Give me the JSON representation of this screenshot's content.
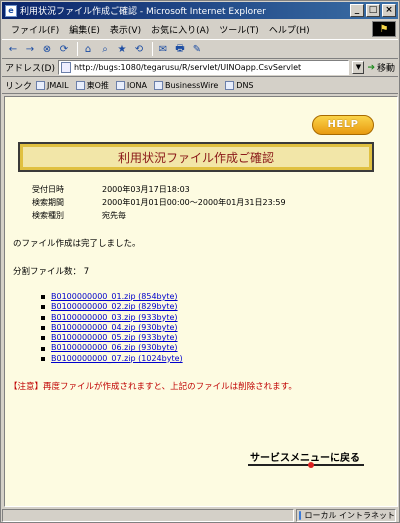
{
  "window": {
    "title": "利用状況ファイル作成ご確認 - Microsoft Internet Explorer",
    "app_icon": "e",
    "controls": [
      "_",
      "□",
      "×"
    ]
  },
  "menubar": {
    "items": [
      "ファイル(F)",
      "編集(E)",
      "表示(V)",
      "お気に入り(A)",
      "ツール(T)",
      "ヘルプ(H)"
    ]
  },
  "toolbar": {
    "buttons": [
      "←",
      "→",
      "⊗",
      "⟳",
      "⌂",
      "⌕",
      "★",
      "⟲",
      "✉",
      "🖶",
      "✎"
    ]
  },
  "address": {
    "label": "アドレス(D)",
    "url": "http://bugs:1080/tegarusu/R/servlet/UINOapp.CsvServlet",
    "go_label": "移動"
  },
  "links": {
    "label": "リンク",
    "items": [
      "JMAIL",
      "東O推",
      "IONA",
      "BusinessWire",
      "DNS"
    ]
  },
  "page": {
    "help_label": "HELP",
    "title": "利用状況ファイル作成ご確認",
    "info": [
      {
        "label": "受付日時",
        "value": "2000年03月17日18:03"
      },
      {
        "label": "検索期間",
        "value": "2000年01月01日00:00～2000年01月31日23:59"
      },
      {
        "label": "検索種別",
        "value": "宛先毎"
      }
    ],
    "complete_message": "のファイル作成は完了しました。",
    "split_count_label": "分割ファイル数：",
    "split_count": "7",
    "files": [
      "B0100000000_01.zip (854byte)",
      "B0100000000_02.zip (829byte)",
      "B0100000000_03.zip (933byte)",
      "B0100000000_04.zip (930byte)",
      "B0100000000_05.zip (933byte)",
      "B0100000000_06.zip (930byte)",
      "B0100000000_07.zip (1024byte)"
    ],
    "notice": "【注意】再度ファイルが作成されますと、上記のファイルは削除されます。",
    "service_menu_label": "サービスメニューに戻る"
  },
  "status": {
    "zone": "ローカル イントラネット"
  }
}
